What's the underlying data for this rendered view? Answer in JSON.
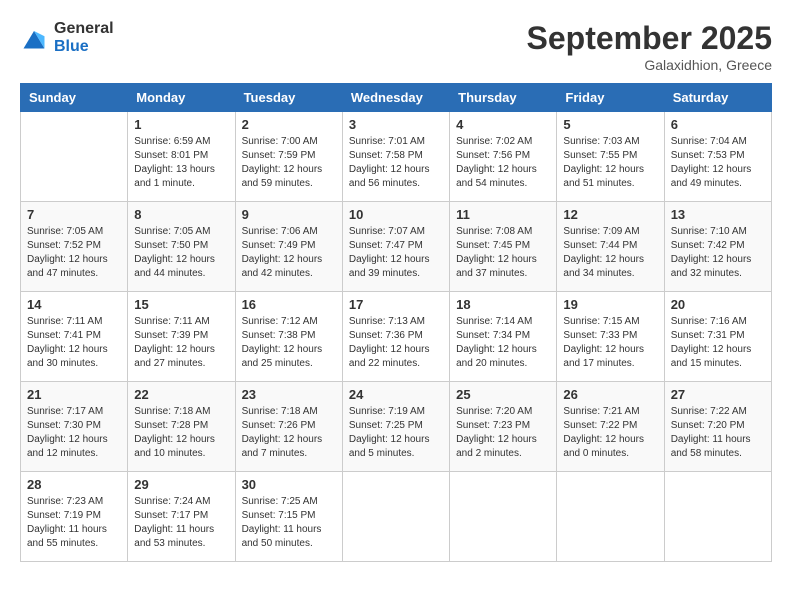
{
  "header": {
    "logo_general": "General",
    "logo_blue": "Blue",
    "month_title": "September 2025",
    "subtitle": "Galaxidhion, Greece"
  },
  "days_of_week": [
    "Sunday",
    "Monday",
    "Tuesday",
    "Wednesday",
    "Thursday",
    "Friday",
    "Saturday"
  ],
  "weeks": [
    [
      {
        "day": "",
        "info": ""
      },
      {
        "day": "1",
        "info": "Sunrise: 6:59 AM\nSunset: 8:01 PM\nDaylight: 13 hours\nand 1 minute."
      },
      {
        "day": "2",
        "info": "Sunrise: 7:00 AM\nSunset: 7:59 PM\nDaylight: 12 hours\nand 59 minutes."
      },
      {
        "day": "3",
        "info": "Sunrise: 7:01 AM\nSunset: 7:58 PM\nDaylight: 12 hours\nand 56 minutes."
      },
      {
        "day": "4",
        "info": "Sunrise: 7:02 AM\nSunset: 7:56 PM\nDaylight: 12 hours\nand 54 minutes."
      },
      {
        "day": "5",
        "info": "Sunrise: 7:03 AM\nSunset: 7:55 PM\nDaylight: 12 hours\nand 51 minutes."
      },
      {
        "day": "6",
        "info": "Sunrise: 7:04 AM\nSunset: 7:53 PM\nDaylight: 12 hours\nand 49 minutes."
      }
    ],
    [
      {
        "day": "7",
        "info": "Sunrise: 7:05 AM\nSunset: 7:52 PM\nDaylight: 12 hours\nand 47 minutes."
      },
      {
        "day": "8",
        "info": "Sunrise: 7:05 AM\nSunset: 7:50 PM\nDaylight: 12 hours\nand 44 minutes."
      },
      {
        "day": "9",
        "info": "Sunrise: 7:06 AM\nSunset: 7:49 PM\nDaylight: 12 hours\nand 42 minutes."
      },
      {
        "day": "10",
        "info": "Sunrise: 7:07 AM\nSunset: 7:47 PM\nDaylight: 12 hours\nand 39 minutes."
      },
      {
        "day": "11",
        "info": "Sunrise: 7:08 AM\nSunset: 7:45 PM\nDaylight: 12 hours\nand 37 minutes."
      },
      {
        "day": "12",
        "info": "Sunrise: 7:09 AM\nSunset: 7:44 PM\nDaylight: 12 hours\nand 34 minutes."
      },
      {
        "day": "13",
        "info": "Sunrise: 7:10 AM\nSunset: 7:42 PM\nDaylight: 12 hours\nand 32 minutes."
      }
    ],
    [
      {
        "day": "14",
        "info": "Sunrise: 7:11 AM\nSunset: 7:41 PM\nDaylight: 12 hours\nand 30 minutes."
      },
      {
        "day": "15",
        "info": "Sunrise: 7:11 AM\nSunset: 7:39 PM\nDaylight: 12 hours\nand 27 minutes."
      },
      {
        "day": "16",
        "info": "Sunrise: 7:12 AM\nSunset: 7:38 PM\nDaylight: 12 hours\nand 25 minutes."
      },
      {
        "day": "17",
        "info": "Sunrise: 7:13 AM\nSunset: 7:36 PM\nDaylight: 12 hours\nand 22 minutes."
      },
      {
        "day": "18",
        "info": "Sunrise: 7:14 AM\nSunset: 7:34 PM\nDaylight: 12 hours\nand 20 minutes."
      },
      {
        "day": "19",
        "info": "Sunrise: 7:15 AM\nSunset: 7:33 PM\nDaylight: 12 hours\nand 17 minutes."
      },
      {
        "day": "20",
        "info": "Sunrise: 7:16 AM\nSunset: 7:31 PM\nDaylight: 12 hours\nand 15 minutes."
      }
    ],
    [
      {
        "day": "21",
        "info": "Sunrise: 7:17 AM\nSunset: 7:30 PM\nDaylight: 12 hours\nand 12 minutes."
      },
      {
        "day": "22",
        "info": "Sunrise: 7:18 AM\nSunset: 7:28 PM\nDaylight: 12 hours\nand 10 minutes."
      },
      {
        "day": "23",
        "info": "Sunrise: 7:18 AM\nSunset: 7:26 PM\nDaylight: 12 hours\nand 7 minutes."
      },
      {
        "day": "24",
        "info": "Sunrise: 7:19 AM\nSunset: 7:25 PM\nDaylight: 12 hours\nand 5 minutes."
      },
      {
        "day": "25",
        "info": "Sunrise: 7:20 AM\nSunset: 7:23 PM\nDaylight: 12 hours\nand 2 minutes."
      },
      {
        "day": "26",
        "info": "Sunrise: 7:21 AM\nSunset: 7:22 PM\nDaylight: 12 hours\nand 0 minutes."
      },
      {
        "day": "27",
        "info": "Sunrise: 7:22 AM\nSunset: 7:20 PM\nDaylight: 11 hours\nand 58 minutes."
      }
    ],
    [
      {
        "day": "28",
        "info": "Sunrise: 7:23 AM\nSunset: 7:19 PM\nDaylight: 11 hours\nand 55 minutes."
      },
      {
        "day": "29",
        "info": "Sunrise: 7:24 AM\nSunset: 7:17 PM\nDaylight: 11 hours\nand 53 minutes."
      },
      {
        "day": "30",
        "info": "Sunrise: 7:25 AM\nSunset: 7:15 PM\nDaylight: 11 hours\nand 50 minutes."
      },
      {
        "day": "",
        "info": ""
      },
      {
        "day": "",
        "info": ""
      },
      {
        "day": "",
        "info": ""
      },
      {
        "day": "",
        "info": ""
      }
    ]
  ]
}
